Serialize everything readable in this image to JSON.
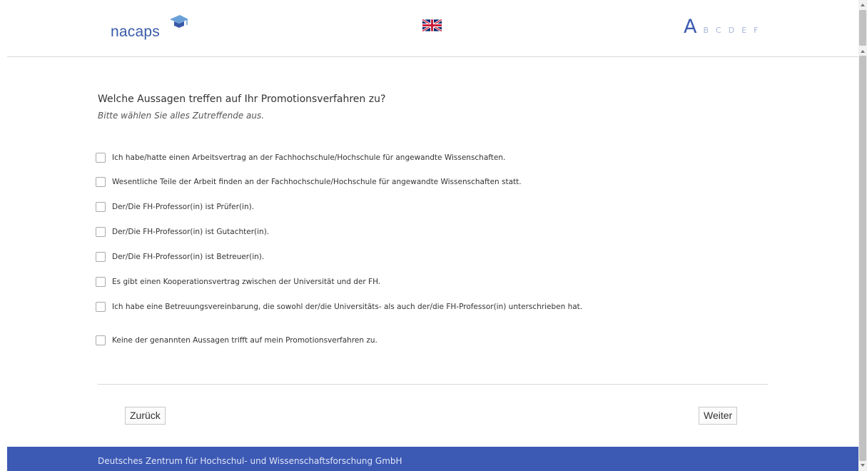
{
  "header": {
    "logo_text": "nacaps",
    "language_flag": "uk-flag-icon",
    "pager": {
      "active": "A",
      "letters": [
        "B",
        "C",
        "D",
        "E",
        "F"
      ]
    }
  },
  "question": {
    "title": "Welche Aussagen treffen auf Ihr Promotionsverfahren zu?",
    "hint": "Bitte wählen Sie alles Zutreffende aus.",
    "options": [
      "Ich habe/hatte einen Arbeitsvertrag an der Fachhochschule/Hochschule für angewandte Wissenschaften.",
      "Wesentliche Teile der Arbeit finden an der Fachhochschule/Hochschule für angewandte Wissenschaften statt.",
      "Der/Die FH-Professor(in) ist Prüfer(in).",
      "Der/Die FH-Professor(in) ist Gutachter(in).",
      "Der/Die FH-Professor(in) ist Betreuer(in).",
      "Es gibt einen Kooperationsvertrag zwischen der Universität und der FH.",
      "Ich habe eine Betreuungsvereinbarung, die sowohl der/die Universitäts- als auch der/die FH-Professor(in) unterschrieben hat.",
      "Keine der genannten Aussagen trifft auf mein Promotionsverfahren zu."
    ]
  },
  "navigation": {
    "back_label": "Zurück",
    "next_label": "Weiter"
  },
  "footer": {
    "text": "Deutsches Zentrum für Hochschul- und Wissenschaftsforschung GmbH"
  },
  "colors": {
    "brand_blue": "#3c59b4",
    "pager_inactive": "#a7b7d9"
  }
}
